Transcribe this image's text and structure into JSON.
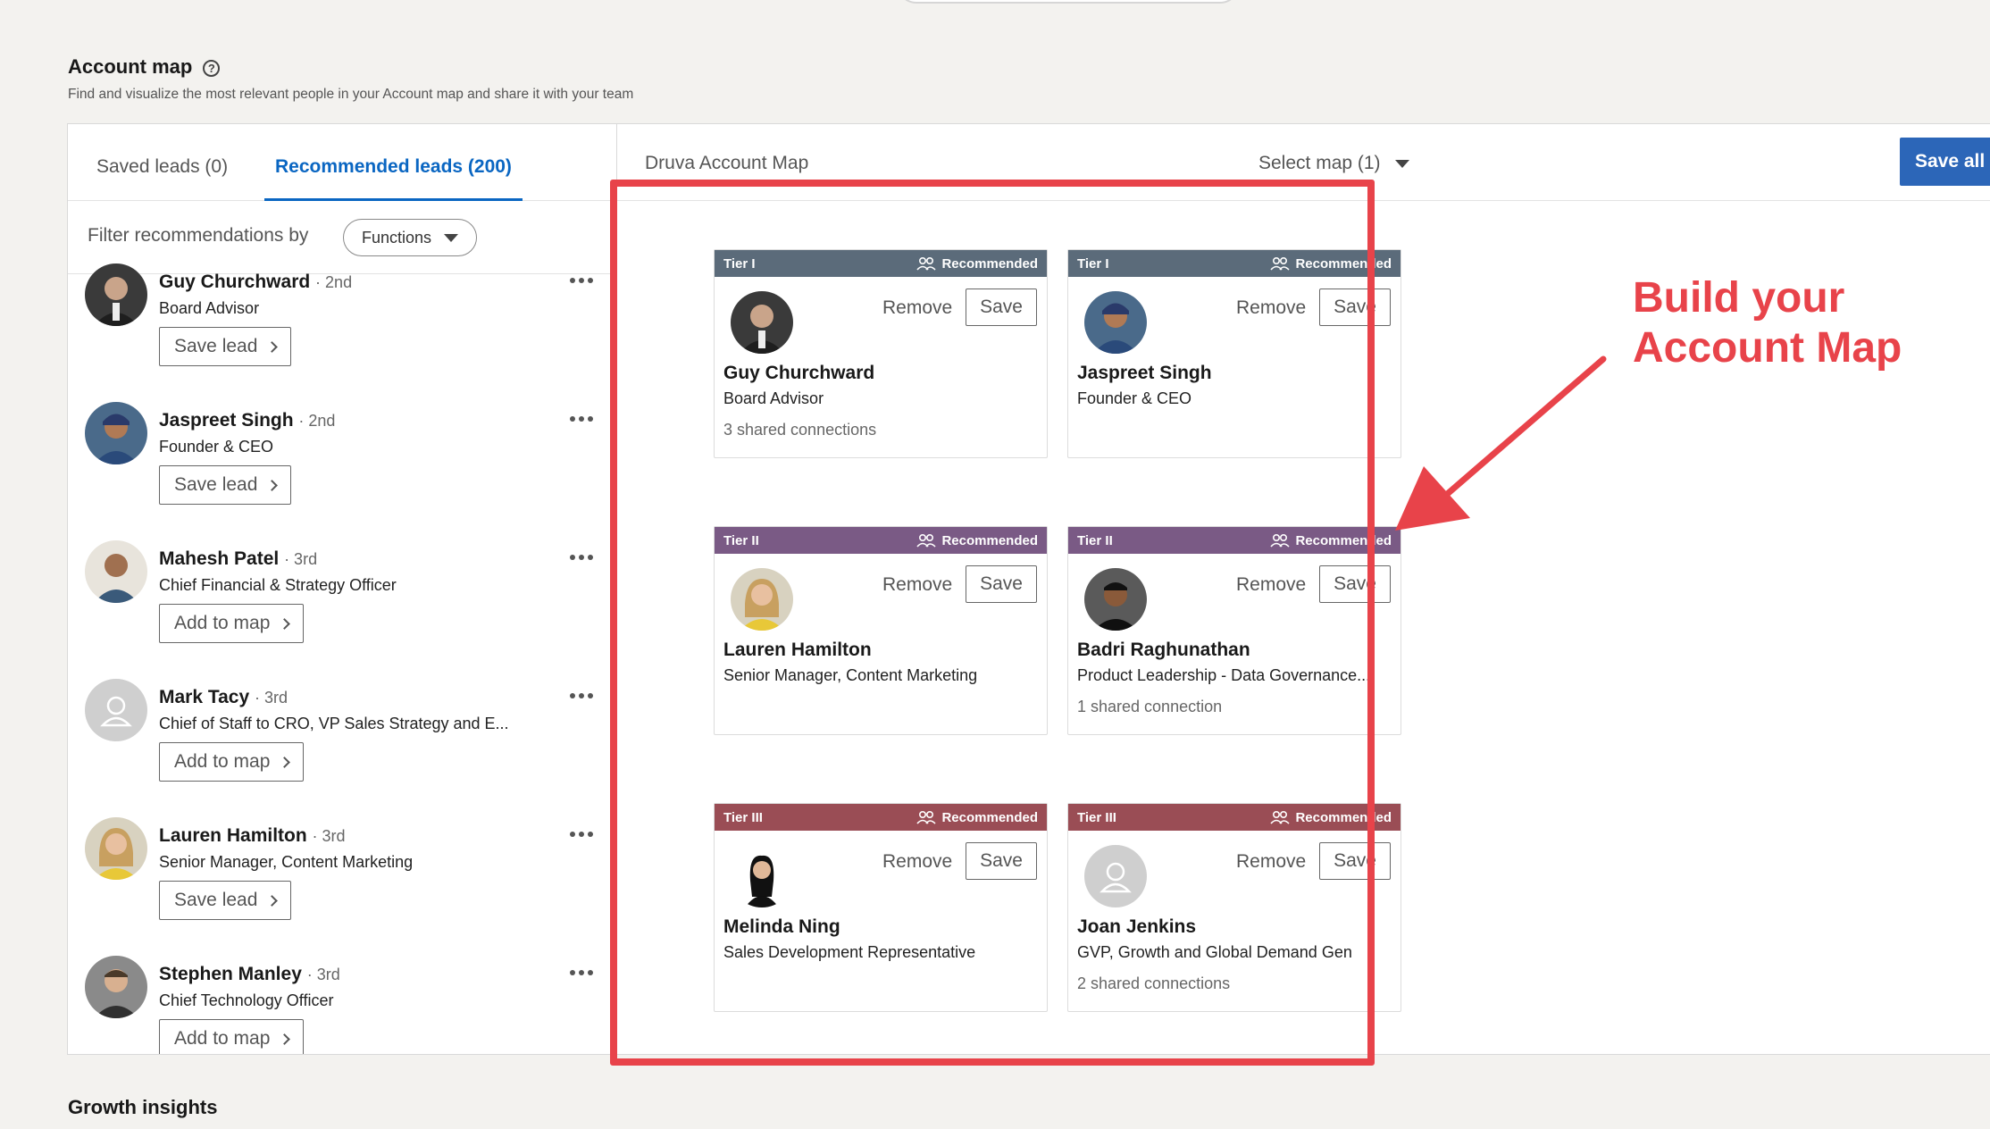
{
  "header": {
    "title": "Account map",
    "help_icon": "help-circle-icon",
    "subtitle": "Find and visualize the most relevant people in your Account map and share it with your team"
  },
  "tabs": [
    {
      "label": "Saved leads (0)",
      "active": false
    },
    {
      "label": "Recommended leads (200)",
      "active": true
    }
  ],
  "filter": {
    "label": "Filter recommendations by",
    "button": "Functions"
  },
  "leads": [
    {
      "name": "Guy Churchward",
      "degree": "· 2nd",
      "title": "Board Advisor",
      "action": "Save lead"
    },
    {
      "name": "Jaspreet Singh",
      "degree": "· 2nd",
      "title": "Founder & CEO",
      "action": "Save lead"
    },
    {
      "name": "Mahesh Patel",
      "degree": "· 3rd",
      "title": "Chief Financial & Strategy Officer",
      "action": "Add to map"
    },
    {
      "name": "Mark Tacy",
      "degree": "· 3rd",
      "title": "Chief of Staff to CRO, VP Sales Strategy and E...",
      "action": "Add to map"
    },
    {
      "name": "Lauren Hamilton",
      "degree": "· 3rd",
      "title": "Senior Manager, Content Marketing",
      "action": "Save lead"
    },
    {
      "name": "Stephen Manley",
      "degree": "· 3rd",
      "title": "Chief Technology Officer",
      "action": "Add to map"
    }
  ],
  "map": {
    "name": "Druva Account Map",
    "select_label": "Select map (1)",
    "save_all": "Save all",
    "remove_label": "Remove",
    "save_label": "Save",
    "recommended_label": "Recommended",
    "tier_colors": {
      "Tier I": "#5b6b7a",
      "Tier II": "#7a5a85",
      "Tier III": "#9a4d55"
    },
    "cards": [
      {
        "tier": "Tier I",
        "name": "Guy Churchward",
        "title": "Board Advisor",
        "shared": "3 shared connections"
      },
      {
        "tier": "Tier I",
        "name": "Jaspreet Singh",
        "title": "Founder & CEO",
        "shared": ""
      },
      {
        "tier": "Tier II",
        "name": "Lauren Hamilton",
        "title": "Senior Manager, Content Marketing",
        "shared": ""
      },
      {
        "tier": "Tier II",
        "name": "Badri Raghunathan",
        "title": "Product Leadership - Data Governance...",
        "shared": "1 shared connection"
      },
      {
        "tier": "Tier III",
        "name": "Melinda Ning",
        "title": "Sales Development Representative",
        "shared": ""
      },
      {
        "tier": "Tier III",
        "name": "Joan Jenkins",
        "title": "GVP, Growth and Global Demand Gen",
        "shared": "2 shared connections"
      }
    ]
  },
  "annotation": {
    "line1": "Build your",
    "line2": "Account Map",
    "color": "#e8434a"
  },
  "footer": {
    "next_section": "Growth insights"
  }
}
